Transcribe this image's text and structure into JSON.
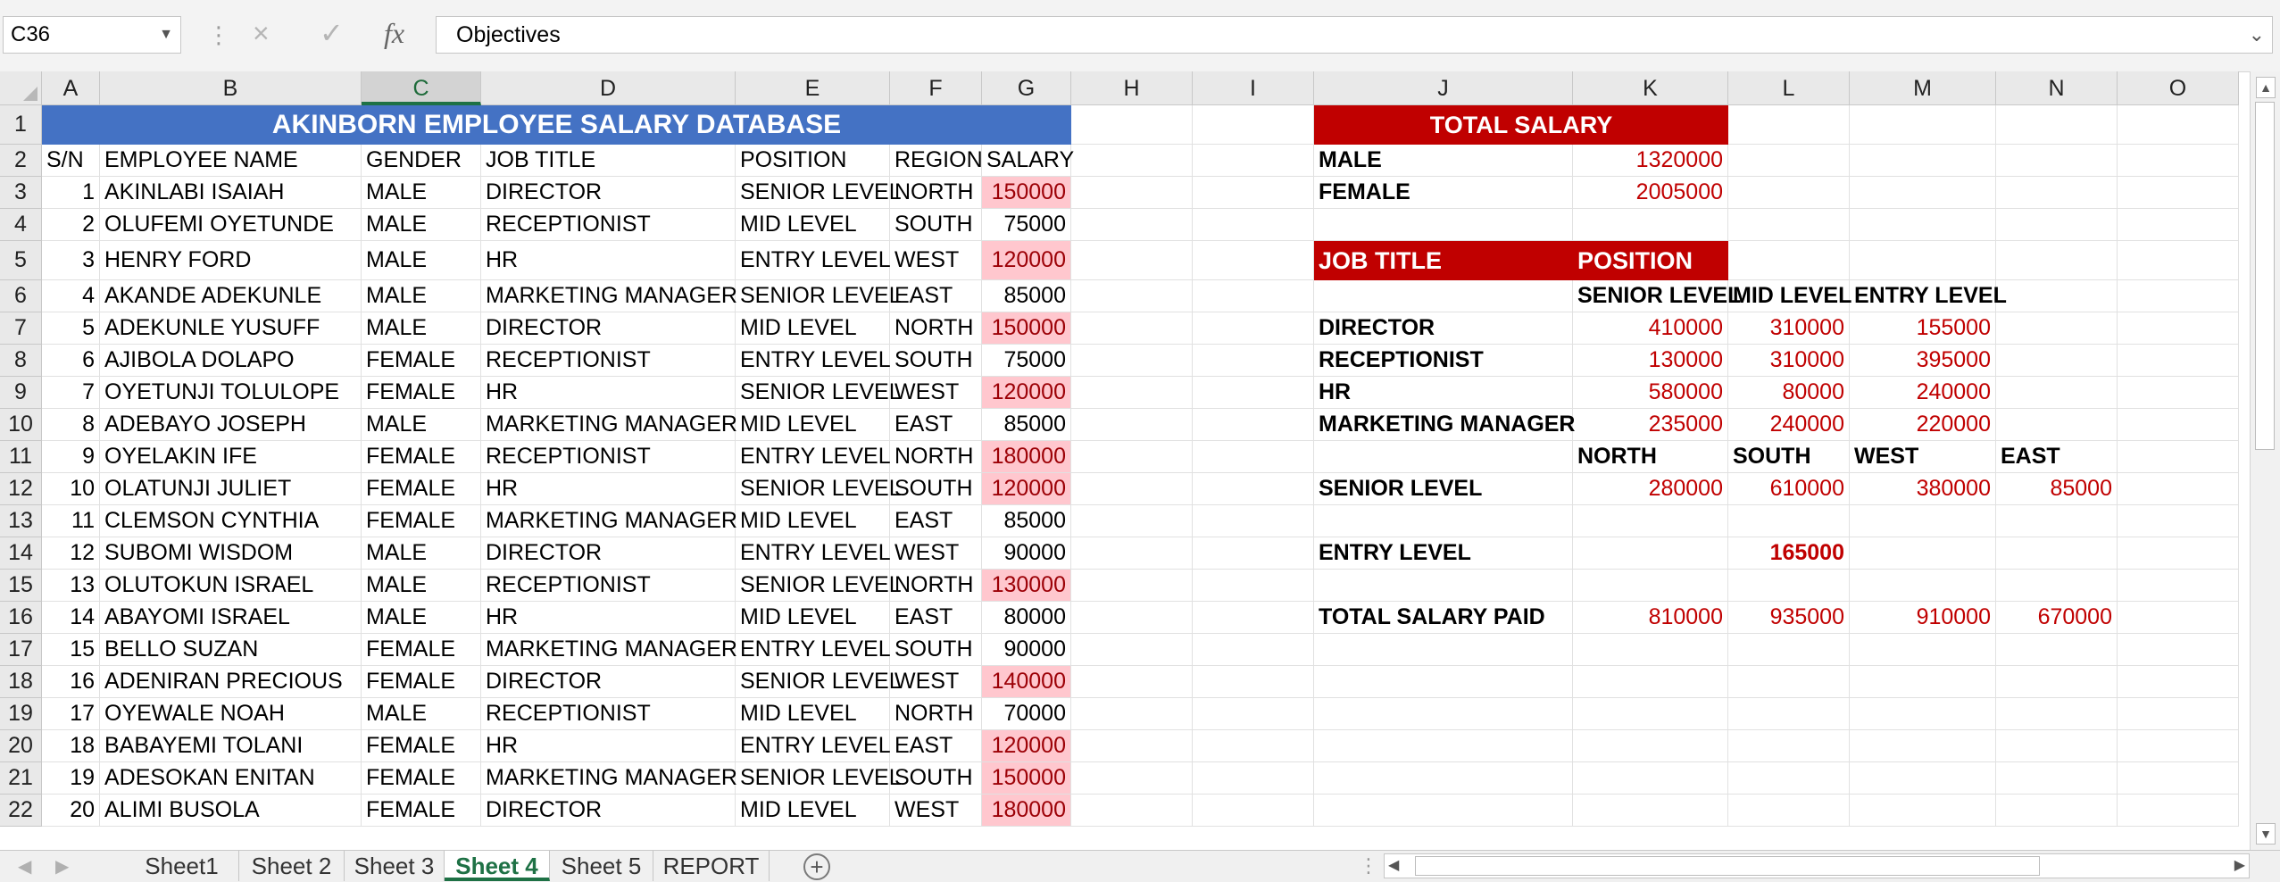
{
  "formula_bar": {
    "name_box": "C36",
    "formula": "Objectives",
    "fx_label": "fx",
    "cancel_icon": "×",
    "enter_icon": "✓"
  },
  "columns": [
    "A",
    "B",
    "C",
    "D",
    "E",
    "F",
    "G",
    "H",
    "I",
    "J",
    "K",
    "L",
    "M",
    "N",
    "O"
  ],
  "active_column": "C",
  "rows": [
    "1",
    "2",
    "3",
    "4",
    "5",
    "6",
    "7",
    "8",
    "9",
    "10",
    "11",
    "12",
    "13",
    "14",
    "15",
    "16",
    "17",
    "18",
    "19",
    "20",
    "21",
    "22"
  ],
  "table": {
    "title": "AKINBORN EMPLOYEE SALARY DATABASE",
    "headers": [
      "S/N",
      "EMPLOYEE NAME",
      "GENDER",
      "JOB TITLE",
      "POSITION",
      "REGION",
      "SALARY"
    ],
    "records": [
      [
        "1",
        "AKINLABI ISAIAH",
        "MALE",
        "DIRECTOR",
        "SENIOR LEVEL",
        "NORTH",
        "150000"
      ],
      [
        "2",
        "OLUFEMI OYETUNDE",
        "MALE",
        "RECEPTIONIST",
        "MID LEVEL",
        "SOUTH",
        "75000"
      ],
      [
        "3",
        "HENRY FORD",
        "MALE",
        "HR",
        "ENTRY LEVEL",
        "WEST",
        "120000"
      ],
      [
        "4",
        "AKANDE ADEKUNLE",
        "MALE",
        "MARKETING MANAGER",
        "SENIOR LEVEL",
        "EAST",
        "85000"
      ],
      [
        "5",
        "ADEKUNLE YUSUFF",
        "MALE",
        "DIRECTOR",
        "MID LEVEL",
        "NORTH",
        "150000"
      ],
      [
        "6",
        "AJIBOLA DOLAPO",
        "FEMALE",
        "RECEPTIONIST",
        "ENTRY LEVEL",
        "SOUTH",
        "75000"
      ],
      [
        "7",
        "OYETUNJI TOLULOPE",
        "FEMALE",
        "HR",
        "SENIOR LEVEL",
        "WEST",
        "120000"
      ],
      [
        "8",
        "ADEBAYO JOSEPH",
        "MALE",
        "MARKETING MANAGER",
        "MID LEVEL",
        "EAST",
        "85000"
      ],
      [
        "9",
        "OYELAKIN IFE",
        "FEMALE",
        "RECEPTIONIST",
        "ENTRY LEVEL",
        "NORTH",
        "180000"
      ],
      [
        "10",
        "OLATUNJI JULIET",
        "FEMALE",
        "HR",
        "SENIOR LEVEL",
        "SOUTH",
        "120000"
      ],
      [
        "11",
        "CLEMSON CYNTHIA",
        "FEMALE",
        "MARKETING MANAGER",
        "MID LEVEL",
        "EAST",
        "85000"
      ],
      [
        "12",
        "SUBOMI WISDOM",
        "MALE",
        "DIRECTOR",
        "ENTRY LEVEL",
        "WEST",
        "90000"
      ],
      [
        "13",
        "OLUTOKUN ISRAEL",
        "MALE",
        "RECEPTIONIST",
        "SENIOR LEVEL",
        "NORTH",
        "130000"
      ],
      [
        "14",
        "ABAYOMI ISRAEL",
        "MALE",
        "HR",
        "MID LEVEL",
        "EAST",
        "80000"
      ],
      [
        "15",
        "BELLO SUZAN",
        "FEMALE",
        "MARKETING MANAGER",
        "ENTRY LEVEL",
        "SOUTH",
        "90000"
      ],
      [
        "16",
        "ADENIRAN PRECIOUS",
        "FEMALE",
        "DIRECTOR",
        "SENIOR LEVEL",
        "WEST",
        "140000"
      ],
      [
        "17",
        "OYEWALE NOAH",
        "MALE",
        "RECEPTIONIST",
        "MID LEVEL",
        "NORTH",
        "70000"
      ],
      [
        "18",
        "BABAYEMI TOLANI",
        "FEMALE",
        "HR",
        "ENTRY LEVEL",
        "EAST",
        "120000"
      ],
      [
        "19",
        "ADESOKAN ENITAN",
        "FEMALE",
        "MARKETING MANAGER",
        "SENIOR LEVEL",
        "SOUTH",
        "150000"
      ],
      [
        "20",
        "ALIMI BUSOLA",
        "FEMALE",
        "DIRECTOR",
        "MID LEVEL",
        "WEST",
        "180000"
      ]
    ],
    "highlighted_salary_rows": [
      0,
      2,
      4,
      6,
      8,
      9,
      12,
      15,
      17,
      18,
      19
    ]
  },
  "summary": {
    "total_salary_label": "TOTAL SALARY",
    "gender_rows": [
      {
        "label": "MALE",
        "value": "1320000"
      },
      {
        "label": "FEMALE",
        "value": "2005000"
      }
    ],
    "job_title_label": "JOB TITLE",
    "position_label": "POSITION",
    "position_headers": [
      "SENIOR LEVEL",
      "MID LEVEL",
      "ENTRY LEVEL"
    ],
    "job_rows": [
      {
        "label": "DIRECTOR",
        "values": [
          "410000",
          "310000",
          "155000"
        ]
      },
      {
        "label": "RECEPTIONIST",
        "values": [
          "130000",
          "310000",
          "395000"
        ]
      },
      {
        "label": "HR",
        "values": [
          "580000",
          "80000",
          "240000"
        ]
      },
      {
        "label": "MARKETING MANAGER",
        "values": [
          "235000",
          "240000",
          "220000"
        ]
      }
    ],
    "region_headers": [
      "NORTH",
      "SOUTH",
      "WEST",
      "EAST"
    ],
    "senior_level": {
      "label": "SENIOR LEVEL",
      "values": [
        "280000",
        "610000",
        "380000",
        "85000"
      ]
    },
    "entry_level": {
      "label": "ENTRY LEVEL",
      "value": "165000"
    },
    "total_paid": {
      "label": "TOTAL SALARY PAID",
      "values": [
        "810000",
        "935000",
        "910000",
        "670000"
      ]
    }
  },
  "sheets": {
    "tabs": [
      "Sheet1",
      "Sheet 2",
      "Sheet 3",
      "Sheet 4",
      "Sheet 5",
      "REPORT"
    ],
    "active": "Sheet 4"
  },
  "colors": {
    "title_banner": "#4472c4",
    "red_banner": "#c00000",
    "highlight_fill": "#ffc7ce",
    "highlight_text": "#9c0006",
    "accent": "#1e7145"
  }
}
